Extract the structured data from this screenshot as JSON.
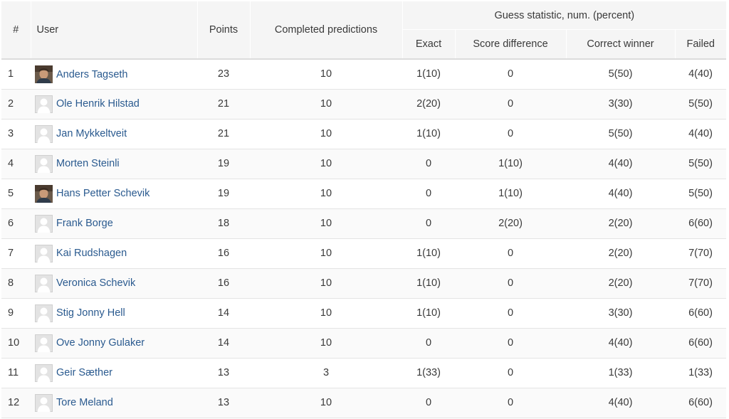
{
  "table": {
    "headers": {
      "rank": "#",
      "user": "User",
      "points": "Points",
      "completed": "Completed predictions",
      "group": "Guess statistic, num. (percent)",
      "exact": "Exact",
      "score_diff": "Score difference",
      "correct_winner": "Correct winner",
      "failed": "Failed"
    },
    "rows": [
      {
        "rank": "1",
        "user": "Anders Tagseth",
        "avatar": "photo",
        "points": "23",
        "completed": "10",
        "exact": "1(10)",
        "score_diff": "0",
        "correct_winner": "5(50)",
        "failed": "4(40)"
      },
      {
        "rank": "2",
        "user": "Ole Henrik Hilstad",
        "avatar": "default",
        "points": "21",
        "completed": "10",
        "exact": "2(20)",
        "score_diff": "0",
        "correct_winner": "3(30)",
        "failed": "5(50)"
      },
      {
        "rank": "3",
        "user": "Jan Mykkeltveit",
        "avatar": "default",
        "points": "21",
        "completed": "10",
        "exact": "1(10)",
        "score_diff": "0",
        "correct_winner": "5(50)",
        "failed": "4(40)"
      },
      {
        "rank": "4",
        "user": "Morten Steinli",
        "avatar": "default",
        "points": "19",
        "completed": "10",
        "exact": "0",
        "score_diff": "1(10)",
        "correct_winner": "4(40)",
        "failed": "5(50)"
      },
      {
        "rank": "5",
        "user": "Hans Petter Schevik",
        "avatar": "photo",
        "points": "19",
        "completed": "10",
        "exact": "0",
        "score_diff": "1(10)",
        "correct_winner": "4(40)",
        "failed": "5(50)"
      },
      {
        "rank": "6",
        "user": "Frank Borge",
        "avatar": "default",
        "points": "18",
        "completed": "10",
        "exact": "0",
        "score_diff": "2(20)",
        "correct_winner": "2(20)",
        "failed": "6(60)"
      },
      {
        "rank": "7",
        "user": "Kai Rudshagen",
        "avatar": "default",
        "points": "16",
        "completed": "10",
        "exact": "1(10)",
        "score_diff": "0",
        "correct_winner": "2(20)",
        "failed": "7(70)"
      },
      {
        "rank": "8",
        "user": "Veronica Schevik",
        "avatar": "default",
        "points": "16",
        "completed": "10",
        "exact": "1(10)",
        "score_diff": "0",
        "correct_winner": "2(20)",
        "failed": "7(70)"
      },
      {
        "rank": "9",
        "user": "Stig Jonny Hell",
        "avatar": "default",
        "points": "14",
        "completed": "10",
        "exact": "1(10)",
        "score_diff": "0",
        "correct_winner": "3(30)",
        "failed": "6(60)"
      },
      {
        "rank": "10",
        "user": "Ove Jonny Gulaker",
        "avatar": "default",
        "points": "14",
        "completed": "10",
        "exact": "0",
        "score_diff": "0",
        "correct_winner": "4(40)",
        "failed": "6(60)"
      },
      {
        "rank": "11",
        "user": "Geir Sæther",
        "avatar": "default",
        "points": "13",
        "completed": "3",
        "exact": "1(33)",
        "score_diff": "0",
        "correct_winner": "1(33)",
        "failed": "1(33)"
      },
      {
        "rank": "12",
        "user": "Tore Meland",
        "avatar": "default",
        "points": "13",
        "completed": "10",
        "exact": "0",
        "score_diff": "0",
        "correct_winner": "4(40)",
        "failed": "6(60)"
      }
    ]
  },
  "colors": {
    "link": "#2a5a8f",
    "header_bg": "#f5f5f5",
    "row_alt_bg": "#fafafa",
    "border": "#e4e4e4"
  }
}
